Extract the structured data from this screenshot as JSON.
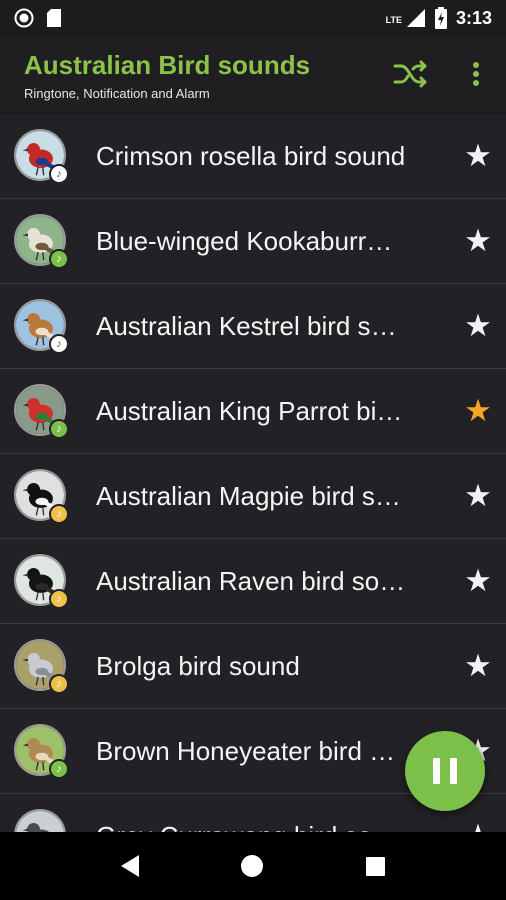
{
  "status_bar": {
    "time": "3:13",
    "network": "LTE",
    "icons": [
      "record-icon",
      "sd-card-icon",
      "signal-icon",
      "battery-charging-icon"
    ]
  },
  "app_bar": {
    "title": "Australian Bird sounds",
    "subtitle": "Ringtone, Notification and Alarm",
    "actions": [
      "shuffle-icon",
      "more-vert-icon"
    ],
    "accent_color": "#8bc34a"
  },
  "sounds": [
    {
      "title": "Crimson rosella bird sound",
      "badge": "white",
      "favorite": false,
      "avatar_colors": [
        "#c8dde6",
        "#c62828",
        "#1e3a8a"
      ]
    },
    {
      "title": "Blue-winged Kookaburra bird sound",
      "badge": "green",
      "favorite": false,
      "avatar_colors": [
        "#8fb38a",
        "#e8e2d4",
        "#6e5a3e"
      ]
    },
    {
      "title": "Australian Kestrel bird sound",
      "badge": "white",
      "favorite": false,
      "avatar_colors": [
        "#9ec3e0",
        "#b87a3a",
        "#f0e0c8"
      ]
    },
    {
      "title": "Australian King Parrot bird sound",
      "badge": "green",
      "favorite": true,
      "avatar_colors": [
        "#8a9a8a",
        "#d32f2f",
        "#2e7d32"
      ]
    },
    {
      "title": "Australian Magpie bird sound",
      "badge": "yellow",
      "favorite": false,
      "avatar_colors": [
        "#e0e0e0",
        "#111111",
        "#f5f5f5"
      ]
    },
    {
      "title": "Australian Raven bird sound",
      "badge": "yellow",
      "favorite": false,
      "avatar_colors": [
        "#dfe6e2",
        "#141414",
        "#2a2a2a"
      ]
    },
    {
      "title": "Brolga bird sound",
      "badge": "yellow",
      "favorite": false,
      "avatar_colors": [
        "#a9a06a",
        "#c8ccd2",
        "#8a8f96"
      ]
    },
    {
      "title": "Brown Honeyeater bird sound",
      "badge": "green",
      "favorite": false,
      "avatar_colors": [
        "#9fc06a",
        "#b08a55",
        "#e8dcc0"
      ]
    },
    {
      "title": "Grey Currawong bird sound",
      "badge": "white",
      "favorite": false,
      "avatar_colors": [
        "#c8d0d6",
        "#4a4a4a",
        "#7a7a7a"
      ]
    }
  ],
  "player": {
    "state": "playing",
    "button_icon": "pause-icon",
    "color": "#7cc04a"
  },
  "nav_bar": {
    "buttons": [
      "back-icon",
      "home-icon",
      "recents-icon"
    ]
  }
}
